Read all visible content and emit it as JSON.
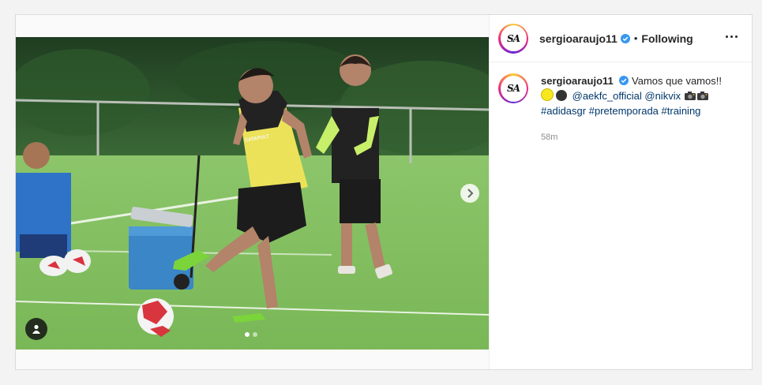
{
  "header": {
    "username": "sergioaraujo11",
    "separator": "•",
    "follow_status": "Following",
    "avatar_text": "SA"
  },
  "caption": {
    "username": "sergioaraujo11",
    "text": "Vamos que vamos!!",
    "mentions": [
      "@aekfc_official",
      "@nikvix"
    ],
    "hashtags": [
      "#adidasgr",
      "#pretemporada",
      "#training"
    ],
    "timestamp": "58m",
    "emoji_colors": [
      "#f8e71c",
      "#333333"
    ]
  },
  "media": {
    "carousel_index": 1,
    "carousel_count": 2,
    "shirt_text": "CATAPULT"
  },
  "icons": {
    "verified": "verified-badge-icon",
    "more": "more-options-icon",
    "next": "chevron-right-icon",
    "user_tag": "user-tag-icon",
    "camera": "camera-emoji-icon"
  },
  "colors": {
    "link": "#00376b",
    "verified": "#3897f0",
    "secondary_text": "#8e8e8e"
  }
}
